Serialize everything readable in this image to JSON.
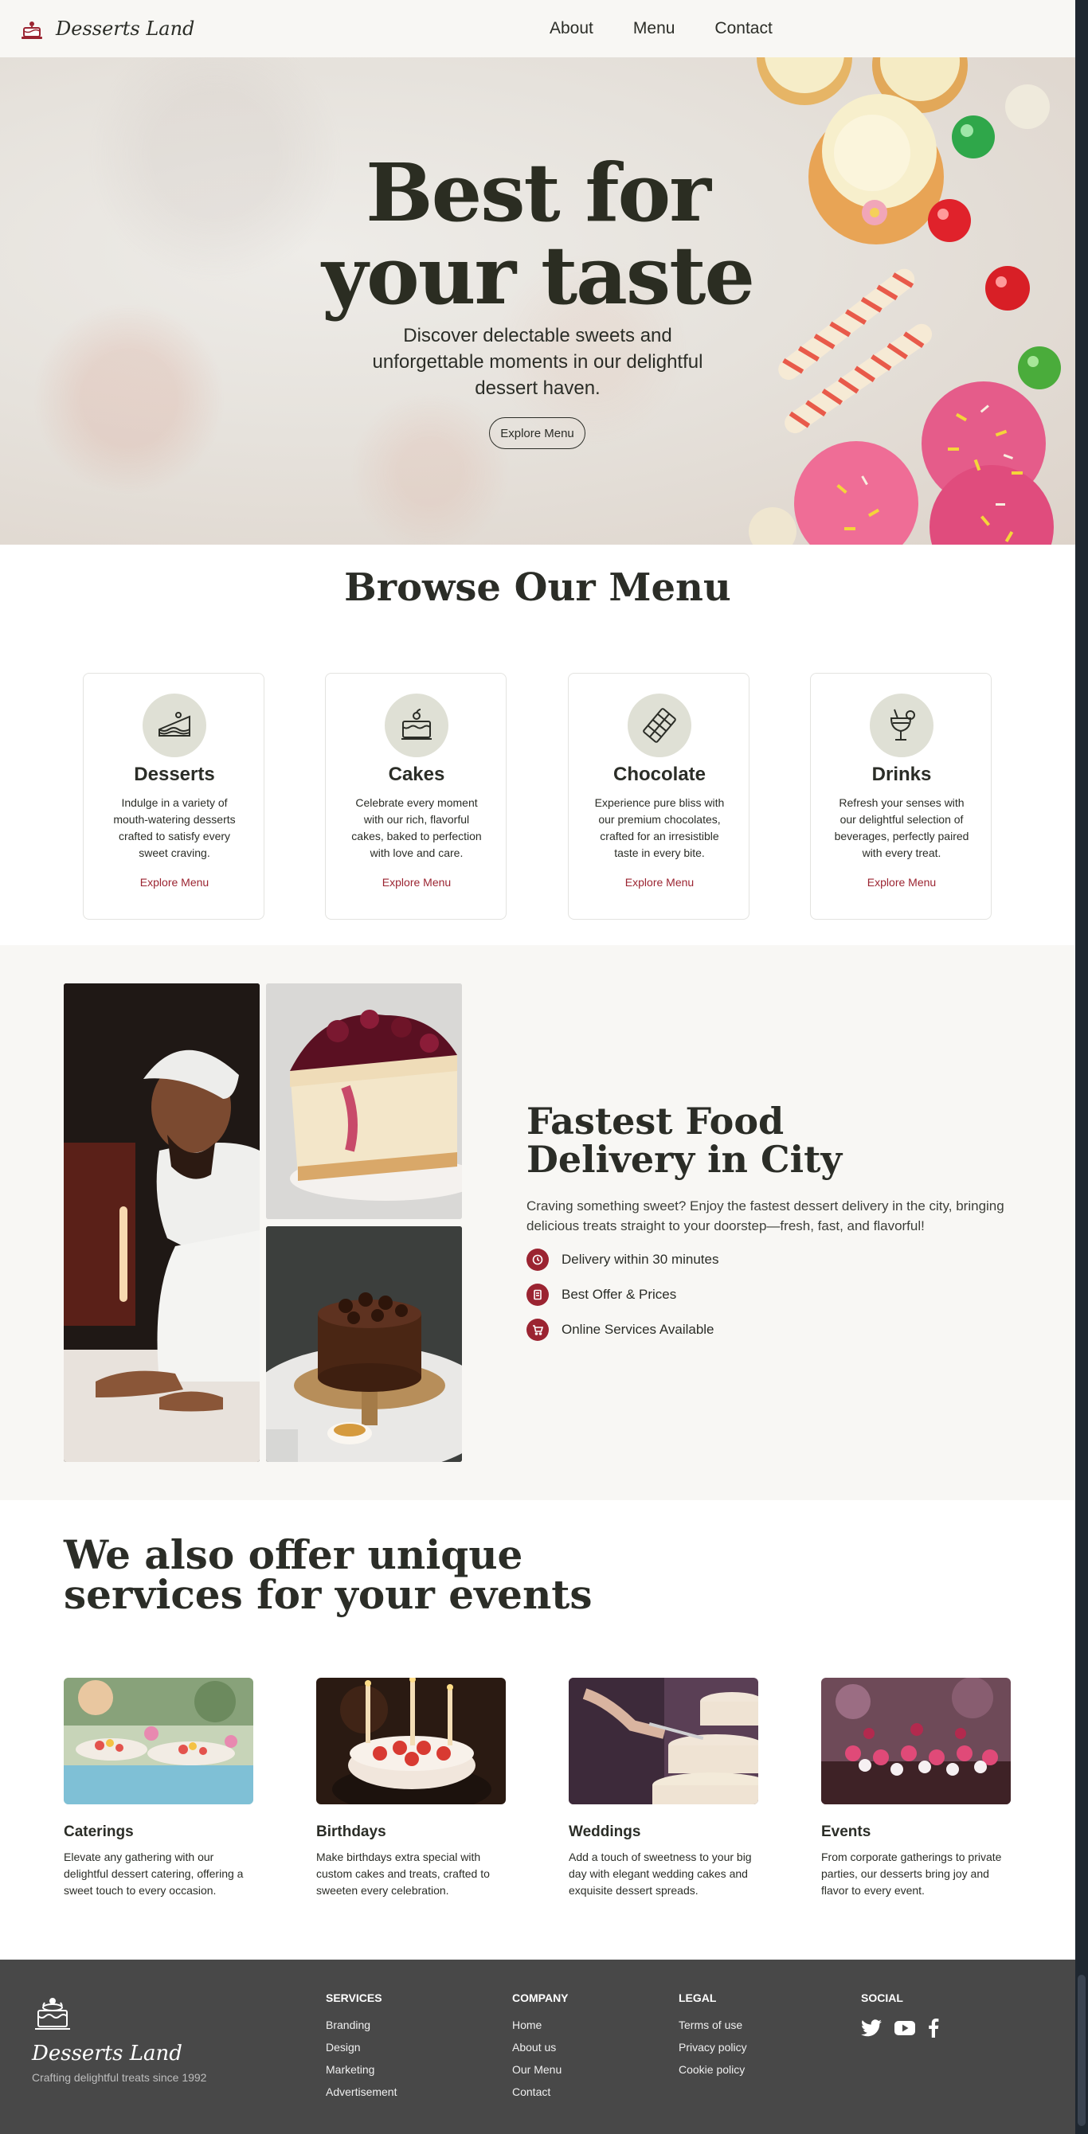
{
  "header": {
    "brand": "Desserts Land",
    "nav": [
      "About",
      "Menu",
      "Contact"
    ]
  },
  "hero": {
    "title_line1": "Best for",
    "title_line2": "your taste",
    "subtitle": "Discover delectable sweets and unforgettable moments in our delightful dessert haven.",
    "button": "Explore Menu"
  },
  "browse": {
    "title": "Browse Our Menu",
    "cards": [
      {
        "title": "Desserts",
        "desc": "Indulge in a variety of mouth-watering desserts crafted to satisfy every sweet craving.",
        "link": "Explore Menu",
        "icon": "cake-slice-icon"
      },
      {
        "title": "Cakes",
        "desc": "Celebrate every moment with our rich, flavorful cakes, baked to perfection with love and care.",
        "link": "Explore Menu",
        "icon": "layer-cake-icon"
      },
      {
        "title": "Chocolate",
        "desc": "Experience pure bliss with our premium chocolates, crafted for an irresistible taste in every bite.",
        "link": "Explore Menu",
        "icon": "chocolate-bar-icon"
      },
      {
        "title": "Drinks",
        "desc": "Refresh your senses with our delightful selection of beverages, perfectly paired with every treat.",
        "link": "Explore Menu",
        "icon": "cocktail-glass-icon"
      }
    ]
  },
  "delivery": {
    "title_line1": "Fastest Food",
    "title_line2": "Delivery in City",
    "text": "Craving something sweet? Enjoy the fastest dessert delivery in the city, bringing delicious treats straight to your doorstep—fresh, fast, and flavorful!",
    "features": [
      {
        "label": "Delivery within 30 minutes",
        "icon": "clock-icon"
      },
      {
        "label": "Best Offer & Prices",
        "icon": "receipt-icon"
      },
      {
        "label": "Online Services Available",
        "icon": "cart-icon"
      }
    ]
  },
  "services": {
    "title_line1": "We also offer unique",
    "title_line2": "services for your events",
    "items": [
      {
        "name": "Caterings",
        "desc": "Elevate any gathering with our delightful dessert catering, offering a sweet touch to every occasion."
      },
      {
        "name": "Birthdays",
        "desc": "Make birthdays extra special with custom cakes and treats, crafted to sweeten every celebration."
      },
      {
        "name": "Weddings",
        "desc": "Add a touch of sweetness to your big day with elegant wedding cakes and exquisite dessert spreads."
      },
      {
        "name": "Events",
        "desc": "From corporate gatherings to private parties, our desserts bring joy and flavor to every event."
      }
    ]
  },
  "footer": {
    "brand": "Desserts Land",
    "tagline": "Crafting delightful treats since 1992",
    "columns": [
      {
        "heading": "SERVICES",
        "links": [
          "Branding",
          "Design",
          "Marketing",
          "Advertisement"
        ]
      },
      {
        "heading": "COMPANY",
        "links": [
          "Home",
          "About us",
          "Our Menu",
          "Contact"
        ]
      },
      {
        "heading": "LEGAL",
        "links": [
          "Terms of use",
          "Privacy policy",
          "Cookie policy"
        ]
      }
    ],
    "social": {
      "heading": "SOCIAL",
      "icons": [
        "twitter-icon",
        "youtube-icon",
        "facebook-icon"
      ]
    }
  },
  "colors": {
    "accent": "#9b2431",
    "text": "#2b2d27",
    "footer_bg": "#484848",
    "icon_bg": "#dfe0d5",
    "section_bg": "#f8f7f4"
  }
}
